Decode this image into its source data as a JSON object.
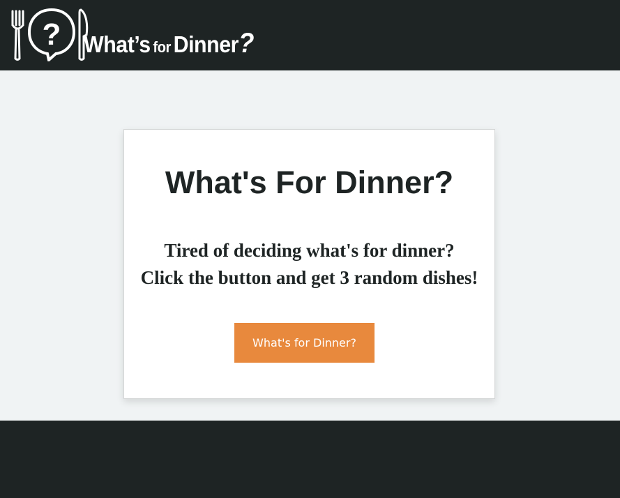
{
  "header": {
    "logo_word1": "What’s",
    "logo_word2": "for",
    "logo_word3": "Dinner",
    "logo_qmark": "?",
    "logo_bubble_mark": "?"
  },
  "card": {
    "title": "What's For Dinner?",
    "subtitle_line1": "Tired of deciding what's for dinner?",
    "subtitle_line2": "Click the button and get 3 random dishes!",
    "button_label": "What's for Dinner?"
  },
  "colors": {
    "dark": "#1e2424",
    "page_bg": "#f0f3f4",
    "accent": "#e8893d",
    "card_bg": "#ffffff"
  }
}
